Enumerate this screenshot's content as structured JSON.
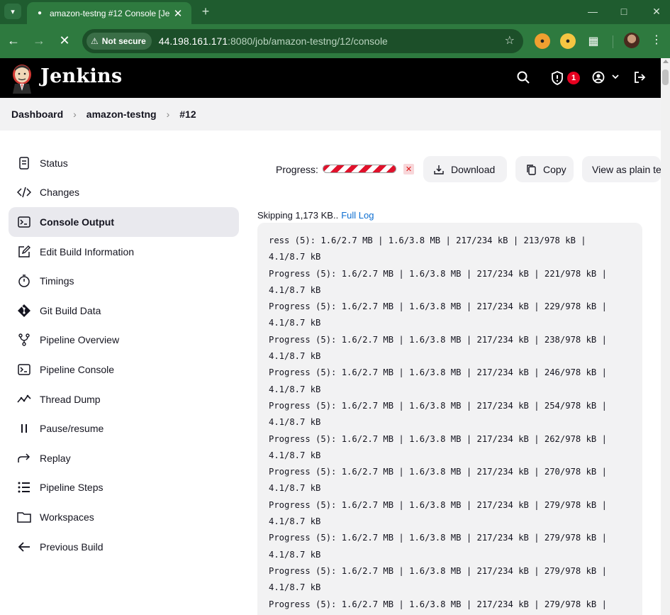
{
  "browser": {
    "tab_title": "amazon-testng #12 Console [Je",
    "url_chip": "Not secure",
    "url_host": "44.198.161.171",
    "url_rest": ":8080/job/amazon-testng/12/console"
  },
  "header": {
    "title": "Jenkins",
    "notification_count": "1"
  },
  "breadcrumb": [
    "Dashboard",
    "amazon-testng",
    "#12"
  ],
  "sidebar": {
    "items": [
      {
        "label": "Status",
        "icon": "document-icon"
      },
      {
        "label": "Changes",
        "icon": "code-icon"
      },
      {
        "label": "Console Output",
        "icon": "terminal-icon",
        "active": true
      },
      {
        "label": "Edit Build Information",
        "icon": "edit-icon"
      },
      {
        "label": "Timings",
        "icon": "stopwatch-icon"
      },
      {
        "label": "Git Build Data",
        "icon": "git-icon"
      },
      {
        "label": "Pipeline Overview",
        "icon": "branch-icon"
      },
      {
        "label": "Pipeline Console",
        "icon": "terminal-icon"
      },
      {
        "label": "Thread Dump",
        "icon": "activity-icon"
      },
      {
        "label": "Pause/resume",
        "icon": "pause-icon"
      },
      {
        "label": "Replay",
        "icon": "replay-arrow-icon"
      },
      {
        "label": "Pipeline Steps",
        "icon": "list-icon"
      },
      {
        "label": "Workspaces",
        "icon": "folder-icon"
      },
      {
        "label": "Previous Build",
        "icon": "arrow-left-icon"
      }
    ]
  },
  "main": {
    "progress_label": "Progress:",
    "download_label": "Download",
    "copy_label": "Copy",
    "plain_label": "View as plain text",
    "skipping_text": "Skipping 1,173 KB..",
    "full_log_link": "Full Log",
    "console_lines": [
      "ress (5): 1.6/2.7 MB | 1.6/3.8 MB | 217/234 kB | 213/978 kB |",
      "4.1/8.7 kB",
      "Progress (5): 1.6/2.7 MB | 1.6/3.8 MB | 217/234 kB | 221/978 kB |",
      "4.1/8.7 kB",
      "Progress (5): 1.6/2.7 MB | 1.6/3.8 MB | 217/234 kB | 229/978 kB |",
      "4.1/8.7 kB",
      "Progress (5): 1.6/2.7 MB | 1.6/3.8 MB | 217/234 kB | 238/978 kB |",
      "4.1/8.7 kB",
      "Progress (5): 1.6/2.7 MB | 1.6/3.8 MB | 217/234 kB | 246/978 kB |",
      "4.1/8.7 kB",
      "Progress (5): 1.6/2.7 MB | 1.6/3.8 MB | 217/234 kB | 254/978 kB |",
      "4.1/8.7 kB",
      "Progress (5): 1.6/2.7 MB | 1.6/3.8 MB | 217/234 kB | 262/978 kB |",
      "4.1/8.7 kB",
      "Progress (5): 1.6/2.7 MB | 1.6/3.8 MB | 217/234 kB | 270/978 kB |",
      "4.1/8.7 kB",
      "Progress (5): 1.6/2.7 MB | 1.6/3.8 MB | 217/234 kB | 279/978 kB |",
      "4.1/8.7 kB",
      "Progress (5): 1.6/2.7 MB | 1.6/3.8 MB | 217/234 kB | 279/978 kB |",
      "4.1/8.7 kB",
      "Progress (5): 1.6/2.7 MB | 1.6/3.8 MB | 217/234 kB | 279/978 kB |",
      "4.1/8.7 kB",
      "Progress (5): 1.6/2.7 MB | 1.6/3.8 MB | 217/234 kB | 279/978 kB |"
    ]
  },
  "colors": {
    "browser_green": "#2e7a3f",
    "header_black": "#000000",
    "link_blue": "#0b6dd1",
    "badge_red": "#e6001f"
  }
}
